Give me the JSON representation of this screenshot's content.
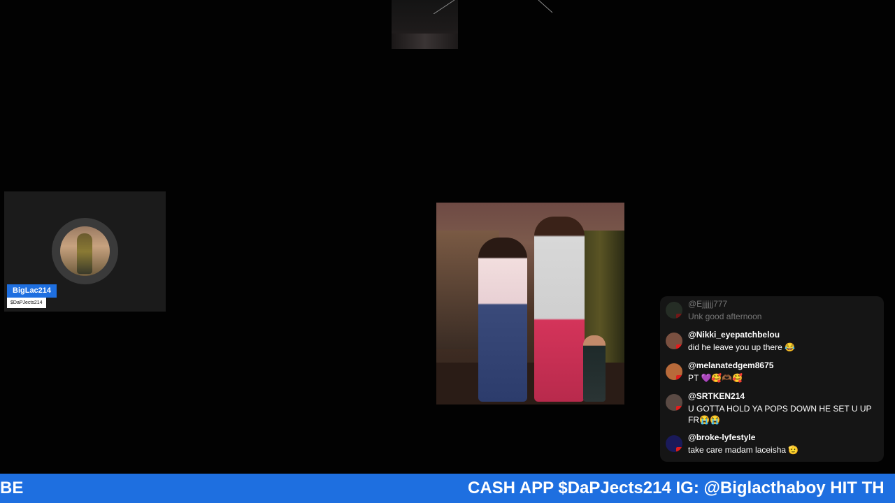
{
  "guest": {
    "name": "BigLac214",
    "cashtag": "$DaPJects214"
  },
  "chat": {
    "messages": [
      {
        "author": "@Ejjjjjj777",
        "text": "Unk good afternoon",
        "faded": true,
        "avatar_color": "#3a4a3a"
      },
      {
        "author": "@Nikki_eyepatchbelou",
        "text": "did he leave you up there 😂",
        "faded": false,
        "avatar_color": "#7a5040"
      },
      {
        "author": "@melanatedgem8675",
        "text": "PT 💜🥰🫶🏾🥰",
        "faded": false,
        "avatar_color": "#b86a3a"
      },
      {
        "author": "@SRTKEN214",
        "text": "U GOTTA HOLD YA POPS DOWN HE SET U UP FR😭😭",
        "faded": false,
        "avatar_color": "#5a4a44"
      },
      {
        "author": "@broke-lyfestyle",
        "text": "take care madam laceisha 🫡",
        "faded": false,
        "avatar_color": "#1a1a5a"
      }
    ]
  },
  "ticker": {
    "left_fragment": "BE",
    "main_text": "CASH APP $DaPJects214 IG: @Biglacthaboy HIT TH"
  },
  "colors": {
    "accent_blue": "#1e6fe0",
    "youtube_red": "#e21d1d",
    "background": "#020202"
  },
  "icons": {
    "chat_badge": "youtube-icon"
  }
}
